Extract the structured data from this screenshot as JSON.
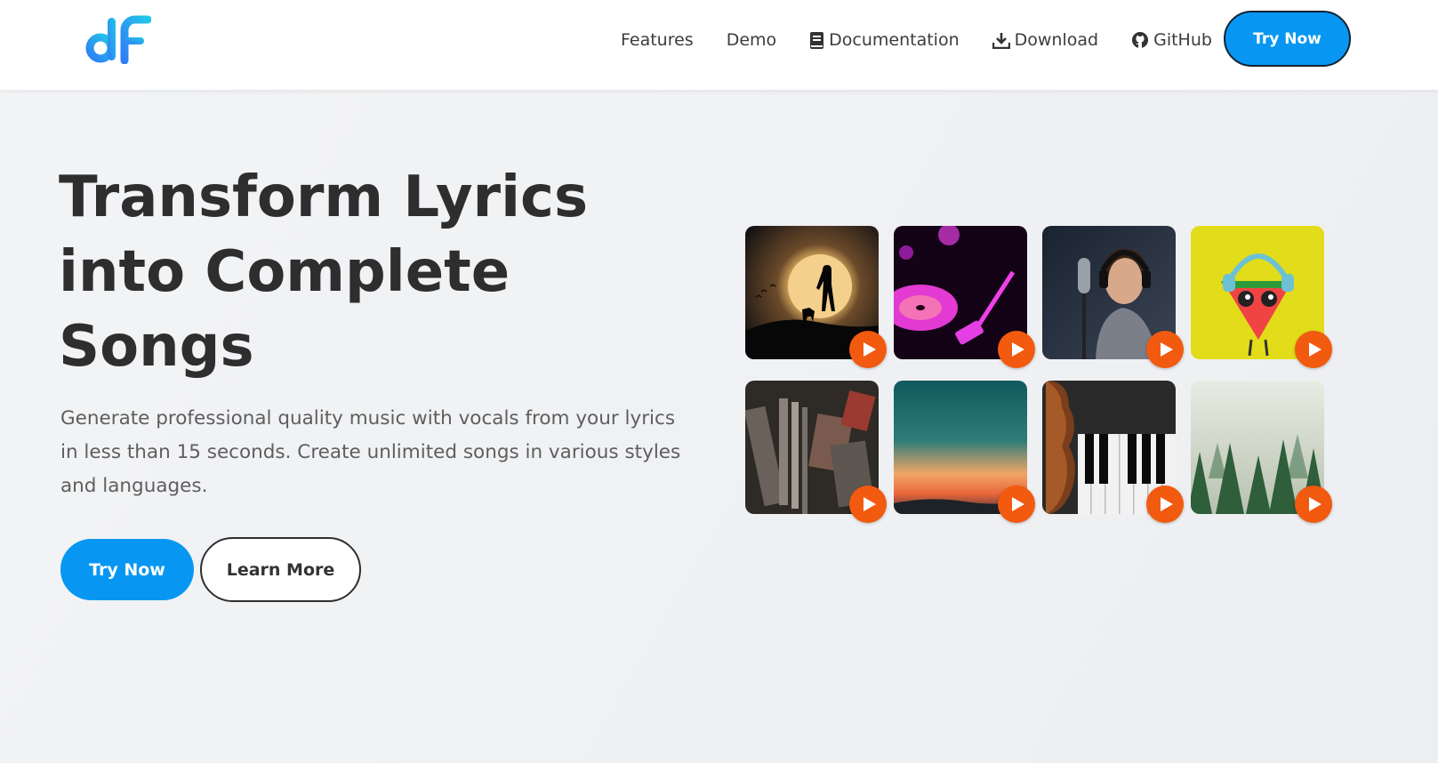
{
  "header": {
    "logo_name": "dF",
    "nav": [
      {
        "label": "Features",
        "icon": ""
      },
      {
        "label": "Demo",
        "icon": ""
      },
      {
        "label": "Documentation",
        "icon": "book-icon"
      },
      {
        "label": "Download",
        "icon": "download-icon"
      },
      {
        "label": "GitHub",
        "icon": "github-icon"
      }
    ],
    "cta_label": "Try Now"
  },
  "hero": {
    "title_lines": [
      "Transform Lyrics",
      "into Complete",
      "Songs"
    ],
    "subtitle": "Generate professional quality music with vocals from your lyrics in less than 15 seconds. Create unlimited songs in various styles and languages.",
    "try_label": "Try Now",
    "learn_label": "Learn More"
  },
  "gallery": {
    "play_icon": "play-icon",
    "play_color": "#f25a0f",
    "tiles": [
      {
        "name": "sunset-guitarist"
      },
      {
        "name": "pink-vinyl"
      },
      {
        "name": "singer-studio"
      },
      {
        "name": "watermelon-headphones"
      },
      {
        "name": "cd-stack"
      },
      {
        "name": "teal-sunset-sky"
      },
      {
        "name": "violin-piano"
      },
      {
        "name": "misty-forest"
      }
    ]
  },
  "colors": {
    "accent": "#0797f2",
    "play": "#f25a0f",
    "title": "#2e2e2e"
  }
}
